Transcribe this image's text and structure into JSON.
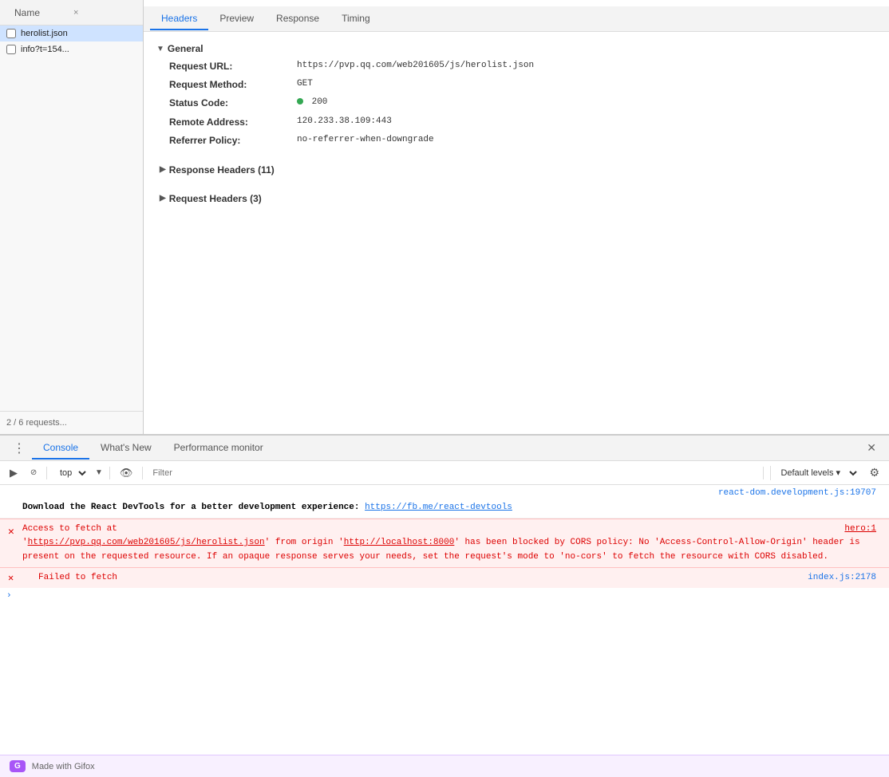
{
  "network": {
    "tabs": [
      {
        "label": "Name",
        "active": false
      },
      {
        "label": "Headers",
        "active": true
      },
      {
        "label": "Preview",
        "active": false
      },
      {
        "label": "Response",
        "active": false
      },
      {
        "label": "Timing",
        "active": false
      }
    ],
    "fileList": [
      {
        "name": "herolist.json",
        "selected": true,
        "checked": false
      },
      {
        "name": "info?t=154...",
        "selected": false,
        "checked": false
      }
    ],
    "requestsCount": "2 / 6 requests...",
    "general": {
      "title": "General",
      "fields": [
        {
          "label": "Request URL:",
          "value": "https://pvp.qq.com/web201605/js/herolist.json"
        },
        {
          "label": "Request Method:",
          "value": "GET"
        },
        {
          "label": "Status Code:",
          "value": "200",
          "hasStatusDot": true
        },
        {
          "label": "Remote Address:",
          "value": "120.233.38.109:443"
        },
        {
          "label": "Referrer Policy:",
          "value": "no-referrer-when-downgrade"
        }
      ]
    },
    "responseHeaders": "Response Headers (11)",
    "requestHeaders": "Request Headers (3)"
  },
  "console": {
    "tabs": [
      {
        "label": "Console",
        "active": true
      },
      {
        "label": "What's New",
        "active": false
      },
      {
        "label": "Performance monitor",
        "active": false
      }
    ],
    "toolbar": {
      "topContext": "top",
      "filterPlaceholder": "Filter",
      "levelsLabel": "Default levels ▾"
    },
    "messages": [
      {
        "type": "source-ref",
        "text": "react-dom.development.js:19707"
      },
      {
        "type": "info",
        "text": "Download the React DevTools for a better development experience: ",
        "linkText": "https://fb.me/react-devtools",
        "linkHref": "#"
      },
      {
        "type": "error",
        "sourceRef": "hero:1",
        "lines": [
          "Access to fetch at",
          "'https://pvp.qq.com/web201605/js/herolist.json' from origin 'http://localhost:8000' has been blocked by CORS policy: No 'Access-Control-Allow-Origin' header is present on the requested resource. If an opaque response serves your needs, set the request's mode to 'no-cors' to fetch the resource with CORS disabled."
        ],
        "linkText": "https://pvp.qq.com/web201605/js/herolist.json",
        "linkHref2": "http://localhost:8000"
      },
      {
        "type": "error-short",
        "text": "✗ Failed to fetch",
        "sourceRef": "index.js:2178"
      }
    ],
    "gifox": "Made with Gifox"
  }
}
